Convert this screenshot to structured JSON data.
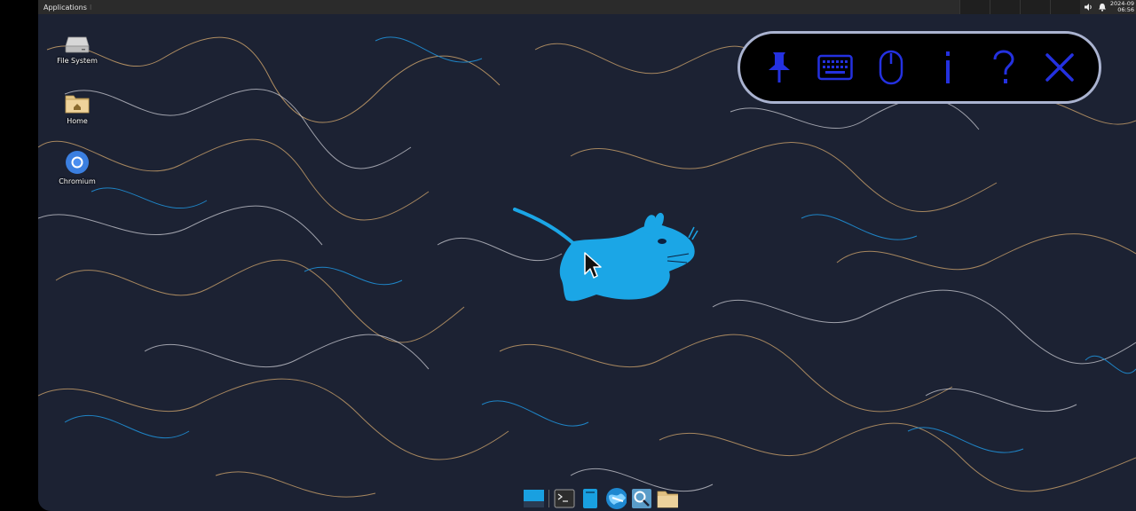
{
  "top_panel": {
    "applications_label": "Applications",
    "clock_date": "2024-09",
    "clock_time": "06:56",
    "tray": [
      "volume-icon",
      "notification-bell-icon"
    ]
  },
  "desktop_icons": [
    {
      "label": "File System",
      "icon": "drive-icon"
    },
    {
      "label": "Home",
      "icon": "home-folder-icon"
    },
    {
      "label": "Chromium",
      "icon": "chromium-icon"
    }
  ],
  "onscreen_keyboard_bar": {
    "buttons": [
      "pin-icon",
      "keyboard-icon",
      "mouse-icon",
      "info-icon",
      "help-icon",
      "close-icon"
    ],
    "accent_color": "#2431e0",
    "border_color": "#aab3d0"
  },
  "dock": {
    "items": [
      "show-desktop-icon",
      "terminal-icon",
      "file-manager-icon",
      "web-browser-icon",
      "search-icon",
      "folder-icon"
    ]
  },
  "wallpaper": {
    "background_color": "#1c2233",
    "line_colors": [
      "#c9a06a",
      "#d8d8e0",
      "#1f8fd6"
    ],
    "mascot_color": "#1ba6e6"
  }
}
